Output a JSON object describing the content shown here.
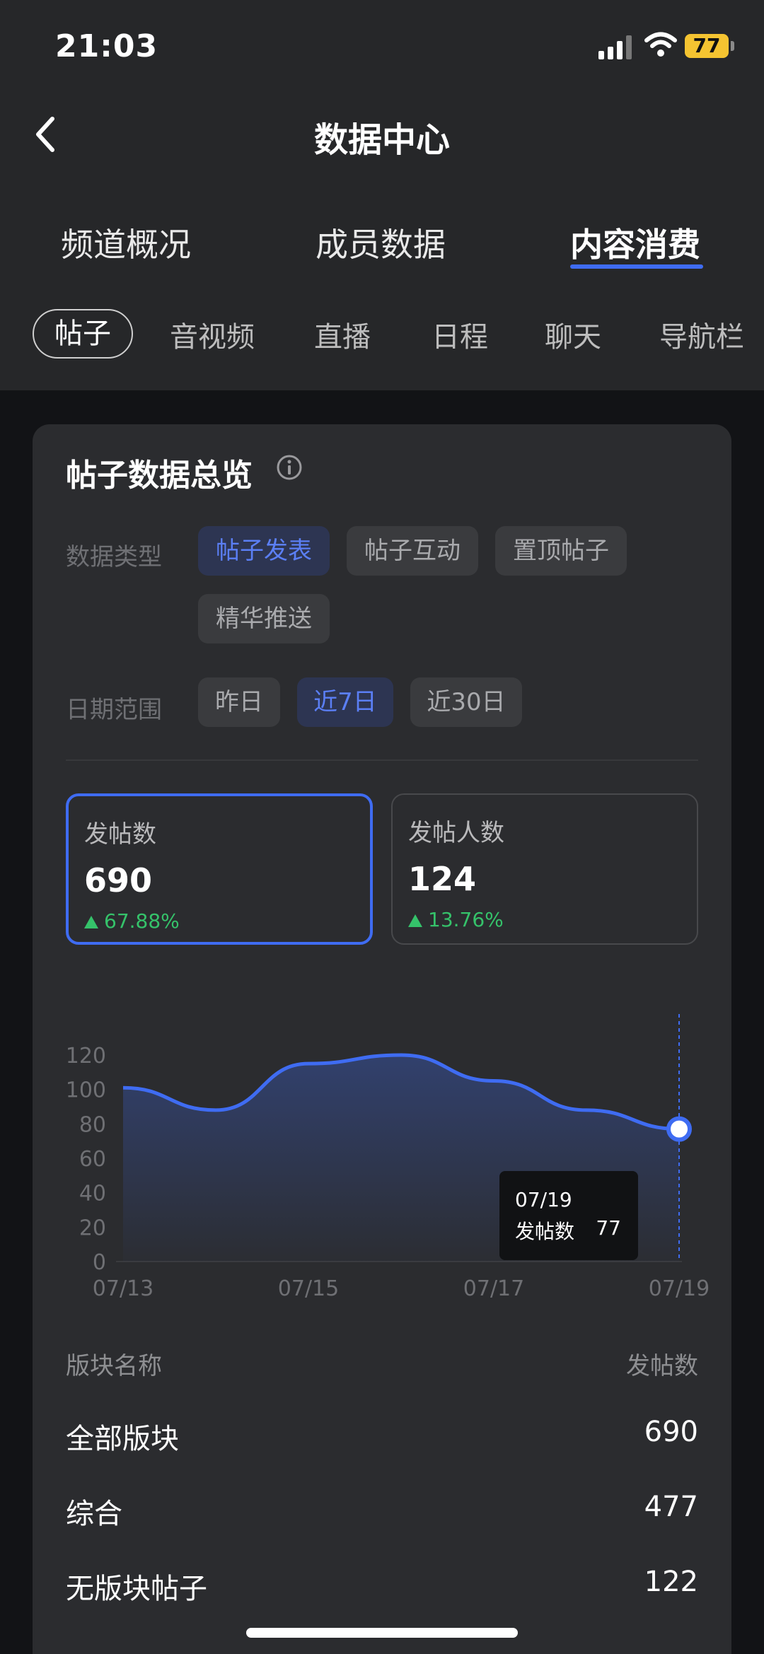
{
  "status_bar": {
    "time": "21:03",
    "battery": "77"
  },
  "header": {
    "title": "数据中心"
  },
  "tabs": [
    {
      "label": "频道概况",
      "active": false
    },
    {
      "label": "成员数据",
      "active": false
    },
    {
      "label": "内容消费",
      "active": true
    }
  ],
  "subtabs": [
    {
      "label": "帖子",
      "active": true
    },
    {
      "label": "音视频"
    },
    {
      "label": "直播"
    },
    {
      "label": "日程"
    },
    {
      "label": "聊天"
    },
    {
      "label": "导航栏"
    }
  ],
  "overview": {
    "title": "帖子数据总览",
    "data_type_label": "数据类型",
    "data_types": [
      {
        "label": "帖子发表",
        "selected": true
      },
      {
        "label": "帖子互动"
      },
      {
        "label": "置顶帖子"
      },
      {
        "label": "精华推送"
      }
    ],
    "date_range_label": "日期范围",
    "date_ranges": [
      {
        "label": "昨日"
      },
      {
        "label": "近7日",
        "selected": true
      },
      {
        "label": "近30日"
      }
    ],
    "metrics": [
      {
        "label": "发帖数",
        "value": "690",
        "change": "67.88%",
        "active": true
      },
      {
        "label": "发帖人数",
        "value": "124",
        "change": "13.76%"
      }
    ]
  },
  "chart_data": {
    "type": "area",
    "x": [
      "07/13",
      "07/14",
      "07/15",
      "07/16",
      "07/17",
      "07/18",
      "07/19"
    ],
    "x_tick_labels": [
      "07/13",
      "07/15",
      "07/17",
      "07/19"
    ],
    "y_tick_labels": [
      "120",
      "100",
      "80",
      "60",
      "40",
      "20",
      "0"
    ],
    "series": [
      {
        "values": [
          101,
          88,
          115,
          120,
          105,
          88,
          77
        ]
      }
    ],
    "ylim": [
      0,
      120
    ],
    "color": "#3f6cf2",
    "tooltip": {
      "date": "07/19",
      "label": "发帖数",
      "value": "77"
    }
  },
  "table": {
    "header_name": "版块名称",
    "header_value": "发帖数",
    "rows": [
      {
        "name": "全部版块",
        "value": "690"
      },
      {
        "name": "综合",
        "value": "477"
      },
      {
        "name": "无版块帖子",
        "value": "122"
      }
    ]
  },
  "colors": {
    "accent": "#3f6cf2",
    "positive": "#35c26a",
    "background": "#121316",
    "card": "#2b2c2f"
  }
}
